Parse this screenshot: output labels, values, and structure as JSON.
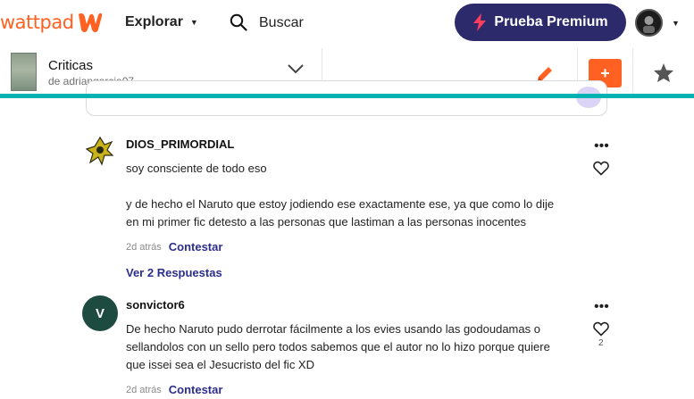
{
  "nav": {
    "logo": "wattpad",
    "explore_label": "Explorar",
    "search_label": "Buscar",
    "premium_label": "Prueba Premium"
  },
  "story": {
    "title": "Criticas",
    "author": "de adriangarcia07"
  },
  "actions": {
    "add_label": "+"
  },
  "comments": [
    {
      "username": "DIOS_PRIMORDIAL",
      "paragraphs": [
        "soy consciente de todo eso",
        "y de hecho el Naruto que estoy jodiendo ese exactamente ese, ya que como lo dije en mi primer fic detesto a las personas que lastiman a las personas inocentes"
      ],
      "time": "2d atrás",
      "reply_label": "Contestar",
      "view_replies": "Ver 2 Respuestas"
    },
    {
      "username": "sonvictor6",
      "avatar_letter": "V",
      "paragraphs": [
        "De hecho Naruto pudo derrotar fácilmente a los evies usando las godoudamas o sellandolos con un sello pero todos sabemos que el autor no lo hizo porque quiere que issei sea el Jesucristo del fic XD"
      ],
      "likes": "2",
      "time": "2d atrás",
      "reply_label": "Contestar"
    }
  ],
  "colors": {
    "brand": "#ff6122",
    "premium_bg": "#2c2a6b",
    "link": "#2d2e8c",
    "divider": "#00b2b2"
  }
}
